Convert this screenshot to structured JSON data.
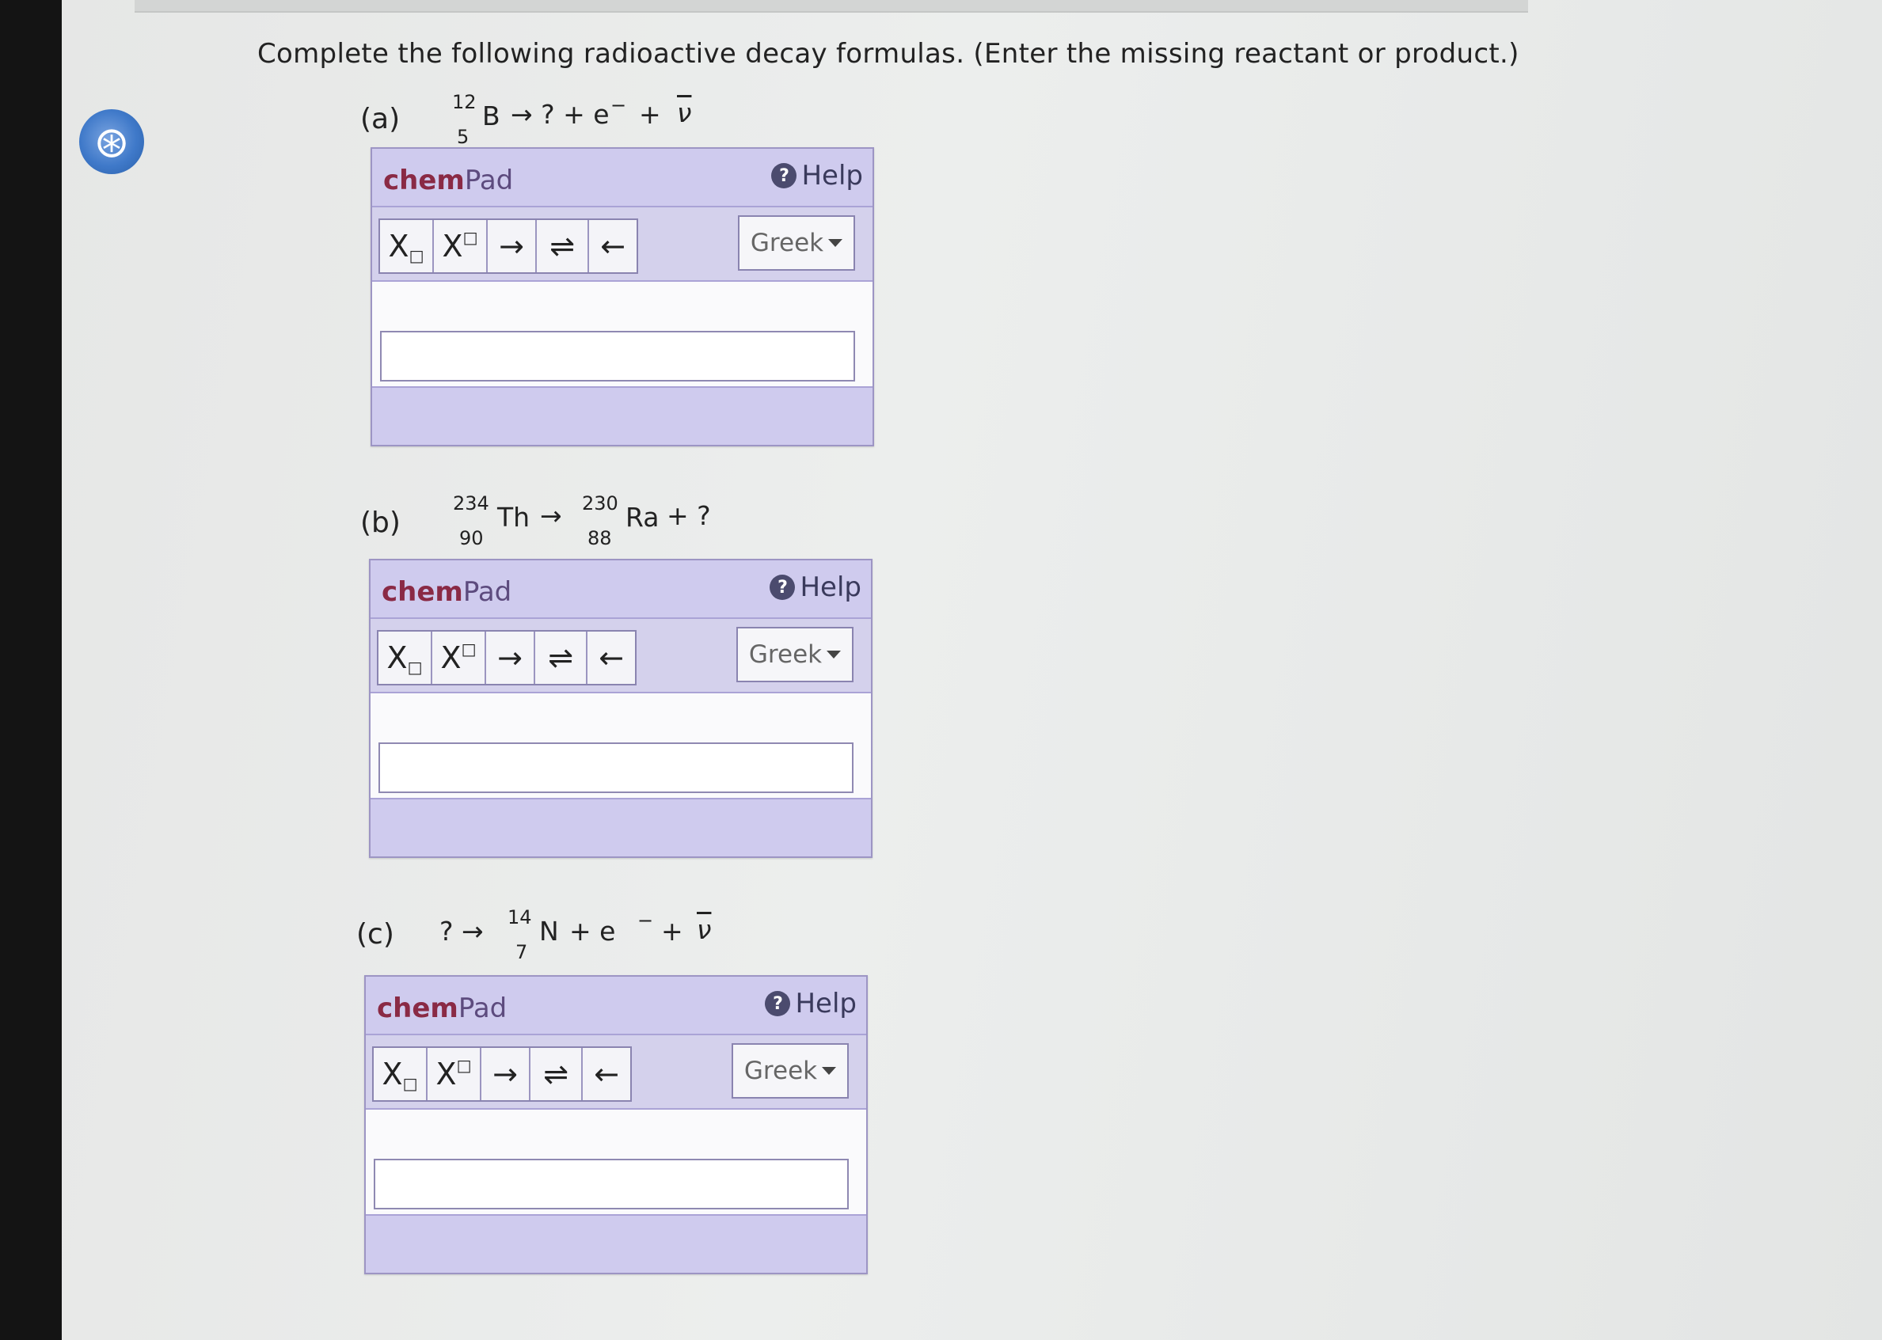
{
  "instructions": "Complete the following radioactive decay formulas. (Enter the missing reactant or product.)",
  "parts": [
    {
      "label": "(a)",
      "equation": {
        "mass": "12",
        "atomic": "5",
        "symbol": "B",
        "rest": "→ ? + e",
        "charge": "−",
        "plus": "+",
        "nu": "ν"
      }
    },
    {
      "label": "(b)",
      "equation": {
        "mass1": "234",
        "atomic1": "90",
        "symbol1": "Th",
        "arrow": "→",
        "mass2": "230",
        "atomic2": "88",
        "symbol2": "Ra",
        "rest": "+ ?"
      }
    },
    {
      "label": "(c)",
      "equation": {
        "lead": "? →",
        "mass": "14",
        "atomic": "7",
        "symbol": "N",
        "rest": "+ e",
        "charge": "−",
        "plus": "+",
        "nu": "ν"
      }
    }
  ],
  "chempad": {
    "title_bold": "chem",
    "title_rest": "Pad",
    "help_label": "Help",
    "help_icon": "?",
    "tools": {
      "subscript": "X",
      "superscript": "X",
      "arrow": "→",
      "equilibrium": "⇌",
      "backspace": "←"
    },
    "greek_label": "Greek"
  }
}
